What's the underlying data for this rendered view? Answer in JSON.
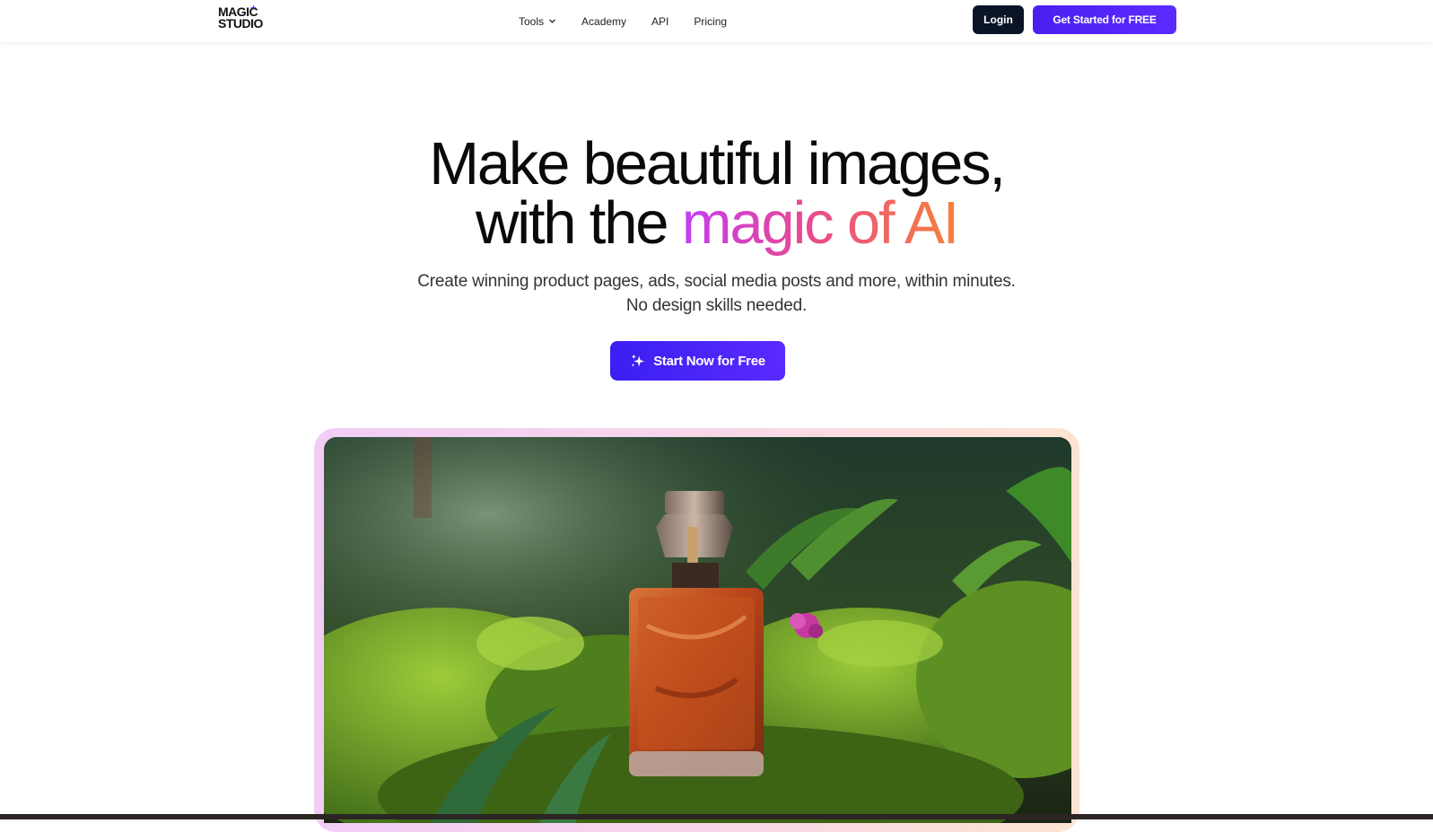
{
  "header": {
    "logo": {
      "line1": "MAGIC",
      "line2": "STUDIO"
    },
    "nav": [
      {
        "label": "Tools"
      },
      {
        "label": "Academy"
      },
      {
        "label": "API"
      },
      {
        "label": "Pricing"
      }
    ],
    "login_label": "Login",
    "cta_label": "Get Started for FREE"
  },
  "hero": {
    "headline_line1": "Make beautiful images,",
    "headline_line2_prefix": "with the",
    "headline_line2_highlight": "magic of AI",
    "subtext_line1": "Create winning product pages, ads, social media posts and more, within minutes.",
    "subtext_line2": "No design skills needed.",
    "cta_label": "Start Now for Free"
  },
  "colors": {
    "brand_purple": "#4a1ff0",
    "login_navy": "#0b1426",
    "gradient_start": "#c43cf5",
    "gradient_end": "#f7813a"
  },
  "icons": [
    "sparkle-icon",
    "chevron-down-icon"
  ]
}
